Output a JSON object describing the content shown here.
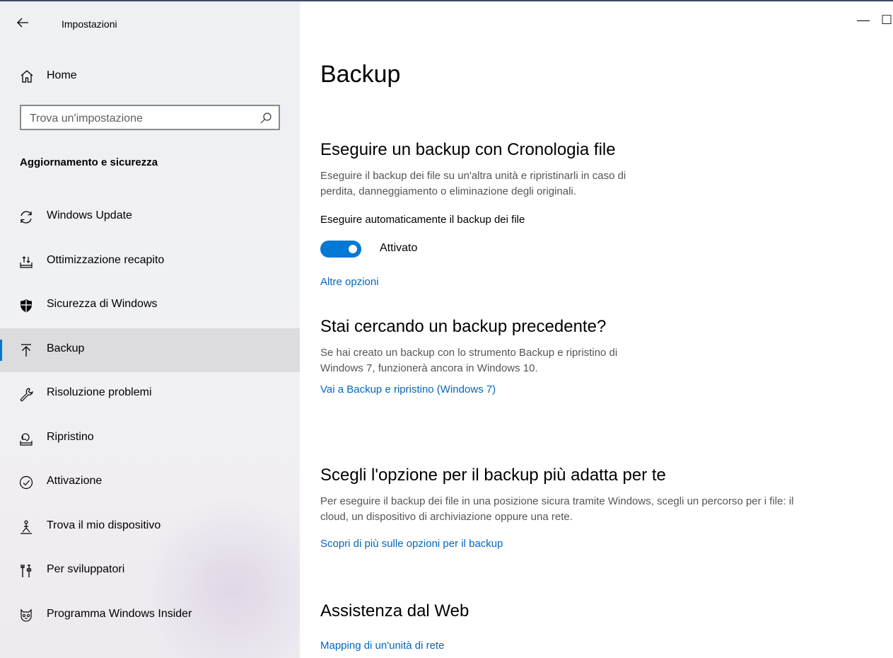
{
  "window": {
    "title": "Impostazioni",
    "minimize_glyph": "—",
    "maximize_glyph": "☐"
  },
  "sidebar": {
    "home_label": "Home",
    "search_placeholder": "Trova un'impostazione",
    "section_title": "Aggiornamento e sicurezza",
    "items": [
      {
        "label": "Windows Update",
        "icon": "refresh-icon"
      },
      {
        "label": "Ottimizzazione recapito",
        "icon": "delivery-optimization-icon"
      },
      {
        "label": "Sicurezza di Windows",
        "icon": "shield-icon"
      },
      {
        "label": "Backup",
        "icon": "backup-icon",
        "selected": true
      },
      {
        "label": "Risoluzione problemi",
        "icon": "wrench-icon"
      },
      {
        "label": "Ripristino",
        "icon": "recovery-icon"
      },
      {
        "label": "Attivazione",
        "icon": "check-circle-icon"
      },
      {
        "label": "Trova il mio dispositivo",
        "icon": "find-device-icon"
      },
      {
        "label": "Per sviluppatori",
        "icon": "developer-tools-icon"
      },
      {
        "label": "Programma Windows Insider",
        "icon": "insider-icon"
      }
    ]
  },
  "main": {
    "title": "Backup",
    "file_history": {
      "heading": "Eseguire un backup con Cronologia file",
      "desc_line1": "Eseguire il backup dei file su un'altra unità e ripristinarli in caso di",
      "desc_line2": "perdita, danneggiamento o eliminazione degli originali.",
      "toggle_label": "Eseguire automaticamente il backup dei file",
      "toggle_state": "Attivato",
      "more_options": "Altre opzioni"
    },
    "older_backup": {
      "heading": "Stai cercando un backup precedente?",
      "desc_line1": "Se hai creato un backup con lo strumento Backup e ripristino di",
      "desc_line2": "Windows 7, funzionerà ancora in Windows 10.",
      "link": "Vai a Backup e ripristino (Windows 7)"
    },
    "choose_option": {
      "heading": "Scegli l'opzione per il backup più adatta per te",
      "desc_line1": "Per eseguire il backup dei file in una posizione sicura tramite Windows, scegli un percorso per i file: il",
      "desc_line2": "cloud, un dispositivo di archiviazione oppure una rete.",
      "link": "Scopri di più sulle opzioni per il backup"
    },
    "web_help": {
      "heading": "Assistenza dal Web",
      "link": "Mapping di un'unità di rete"
    }
  },
  "colors": {
    "accent": "#0078d4",
    "link": "#0067c0",
    "sidebar_bg": "#f0f0f3",
    "selected_bg": "#dcdcdf"
  }
}
